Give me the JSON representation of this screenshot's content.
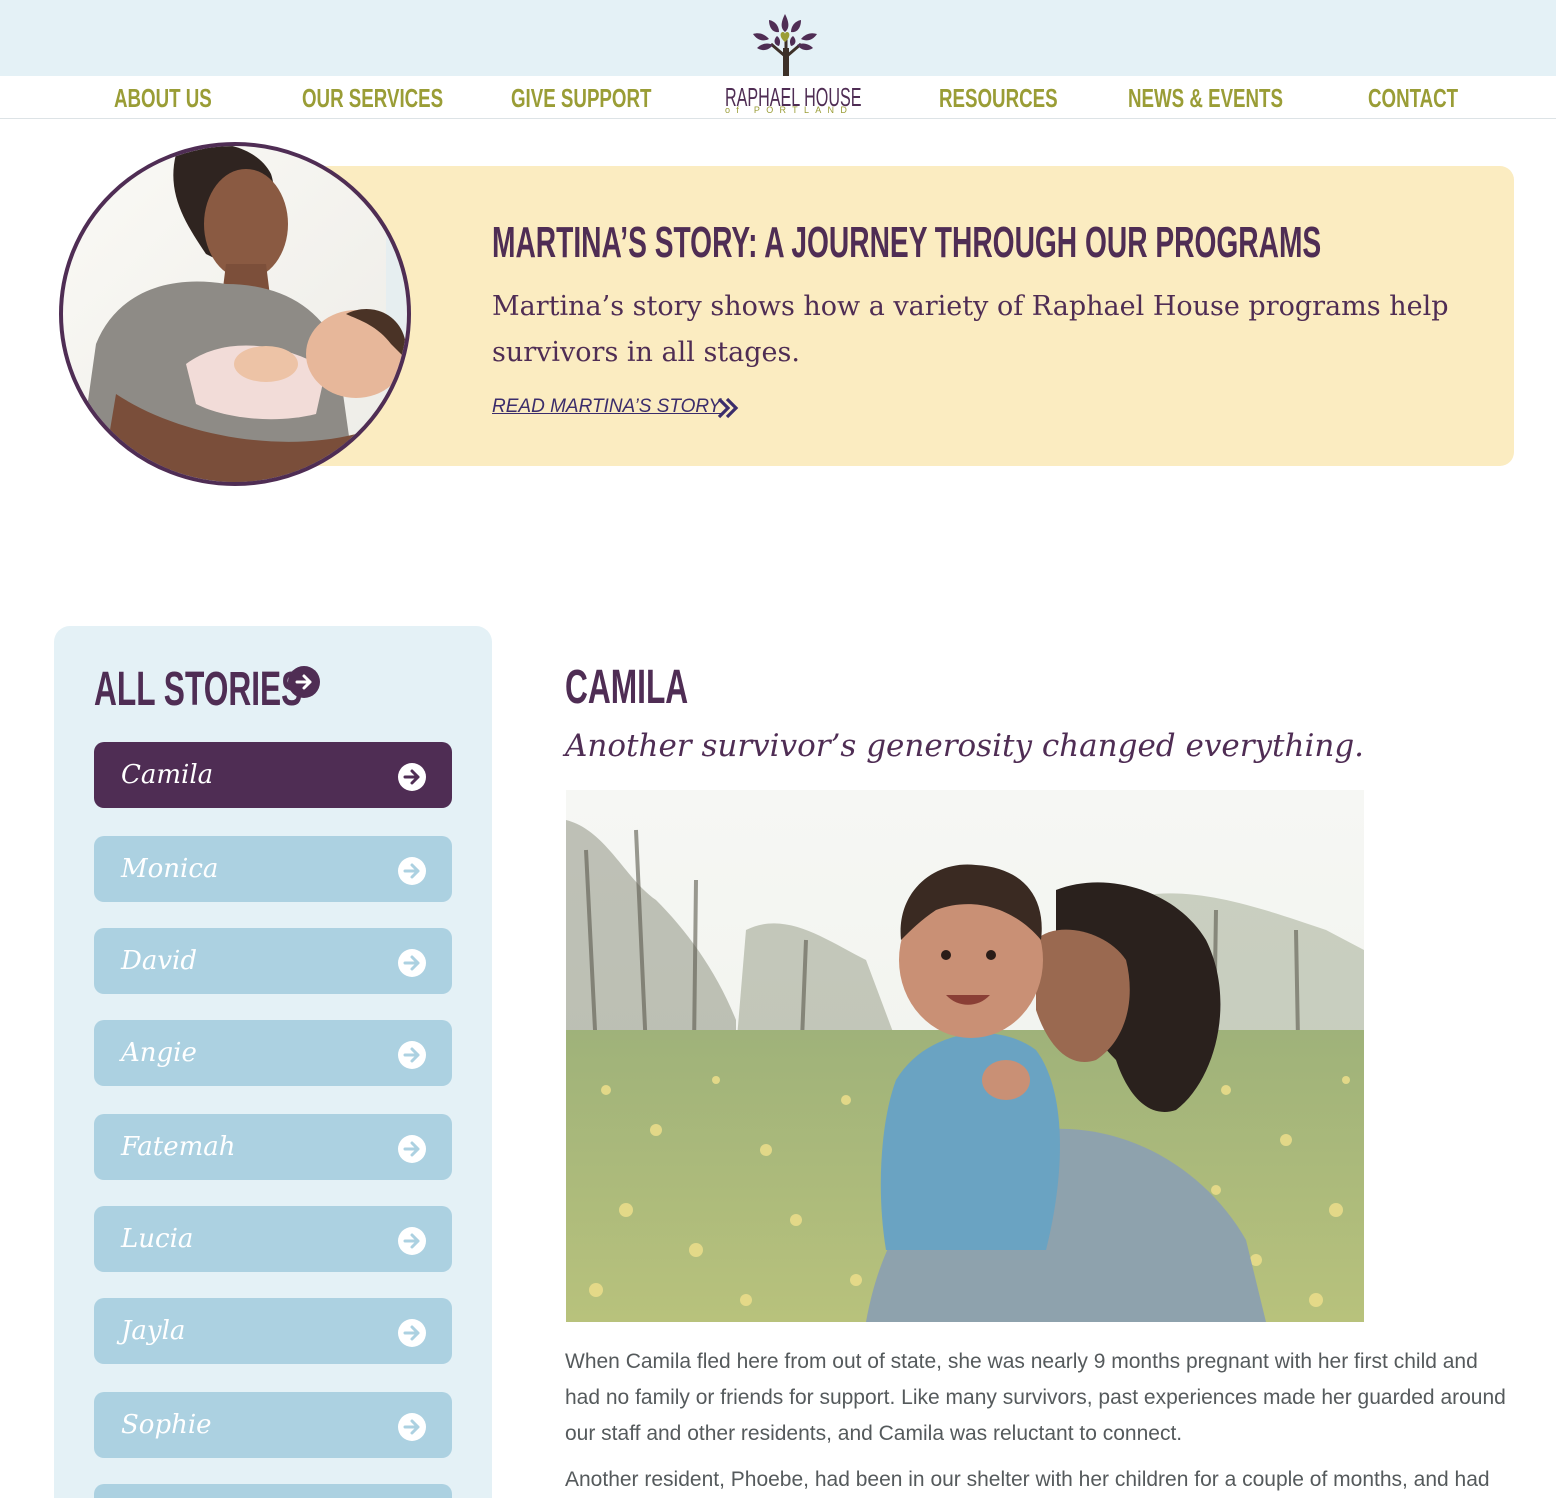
{
  "header": {
    "nav_left": [
      "ABOUT US",
      "OUR SERVICES",
      "GIVE SUPPORT"
    ],
    "nav_right": [
      "RESOURCES",
      "NEWS & EVENTS",
      "CONTACT"
    ],
    "logo_name": "RAPHAEL HOUSE",
    "logo_sub": "of PORTLAND"
  },
  "feature": {
    "title": "MARTINA’S STORY: A JOURNEY THROUGH OUR PROGRAMS",
    "text": "Martina’s story shows how a variety of Raphael House programs help survivors in all stages.",
    "link": "READ  MARTINA’S STORY",
    "photo_icon": "mother-holding-baby-photo"
  },
  "sidebar": {
    "title": "ALL STORIES",
    "stories": [
      "Camila",
      "Monica",
      "David",
      "Angie",
      "Fatemah",
      "Lucia",
      "Jayla",
      "Sophie"
    ],
    "active": "Camila"
  },
  "story": {
    "name": "CAMILA",
    "tagline": "Another survivor’s generosity changed everything.",
    "paragraphs": [
      "When Camila fled here from out of state, she was nearly 9 months pregnant with her first child and had no family or friends for support. Like many survivors, past experiences made her guarded around our staff and other residents, and Camila was reluctant to connect.",
      "Another resident, Phoebe, had been in our shelter with her children for a couple of months, and had"
    ]
  },
  "colors": {
    "plum": "#4f2d54",
    "olive": "#9a9d36",
    "light_blue_bg": "#e4f1f6",
    "story_button": "#acd1e1",
    "feature_bg": "#fbecc1"
  }
}
